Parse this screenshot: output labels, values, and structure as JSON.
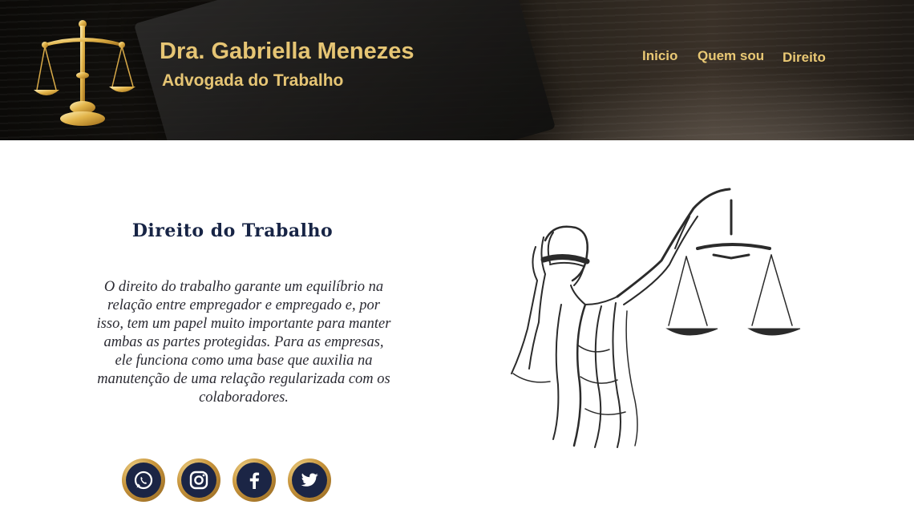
{
  "header": {
    "brand_name": "Dra. Gabriella Menezes",
    "brand_subtitle": "Advogada do Trabalho",
    "logo_icon": "scales-of-justice-icon",
    "nav": [
      {
        "label": "Inicio"
      },
      {
        "label": "Quem sou"
      },
      {
        "label": "Direito"
      }
    ]
  },
  "main": {
    "title": "Direito do Trabalho",
    "body": "O direito do trabalho garante um equilíbrio na relação entre empregador e empregado e, por isso, tem um papel muito importante para manter ambas as partes protegidas. Para as empresas, ele funciona como uma base que auxilia na manutenção de uma relação regularizada com os colaboradores.",
    "illustration": "lady-justice-illustration"
  },
  "social": [
    {
      "icon": "whatsapp-icon"
    },
    {
      "icon": "instagram-icon"
    },
    {
      "icon": "facebook-icon"
    },
    {
      "icon": "twitter-icon"
    }
  ],
  "colors": {
    "gold": "#e6c574",
    "navy": "#172445",
    "header_dark": "#171410"
  }
}
